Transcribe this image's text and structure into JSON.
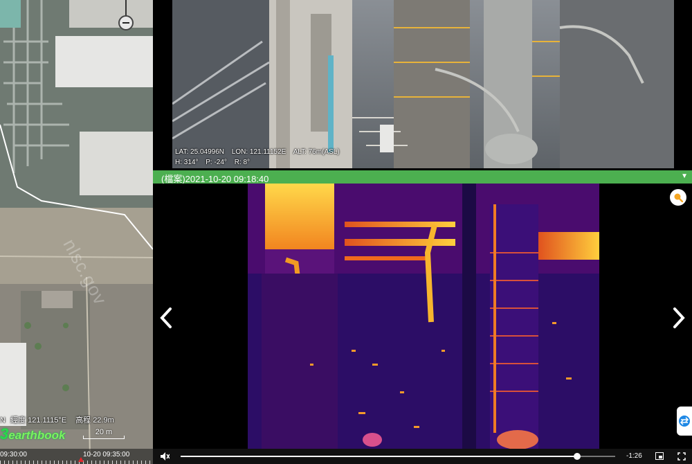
{
  "map": {
    "watermark": "nlsc.gov",
    "longitude_label": "經度",
    "longitude_value": "121.1115°E",
    "longitude_prefix": "N",
    "altitude_label": "高程",
    "altitude_value": "22.9m",
    "brand_digit": "3",
    "brand_name": "earthbook",
    "scale_label": "20 m",
    "zoom_out_icon": "minus-icon"
  },
  "timeline": {
    "start_label": "09:30:00",
    "end_label": "10-20 09:35:00",
    "marker_color": "#e3262c"
  },
  "photo": {
    "lat": "LAT: 25.04996N",
    "lon": "LON: 121.11152E",
    "alt": "ALT: 76m(ASL)",
    "heading": "H: 314°",
    "pitch": "P: -24°",
    "roll": "R: 8°"
  },
  "record": {
    "title": "(檔案)2021-10-20 09:18:40",
    "collapse_icon": "chevron-down-icon",
    "bar_color": "#4caf50"
  },
  "viewer": {
    "prev_icon": "chevron-left-icon",
    "next_icon": "chevron-right-icon",
    "search_icon": "magnifier-icon",
    "search_color": "#f5a623",
    "side_tab_icon": "swap-icon"
  },
  "player": {
    "remaining": "-1:26",
    "progress": 0.913,
    "mute_icon": "muted-speaker-icon",
    "pip_icon": "picture-in-picture-icon",
    "fullscreen_icon": "fullscreen-icon"
  }
}
